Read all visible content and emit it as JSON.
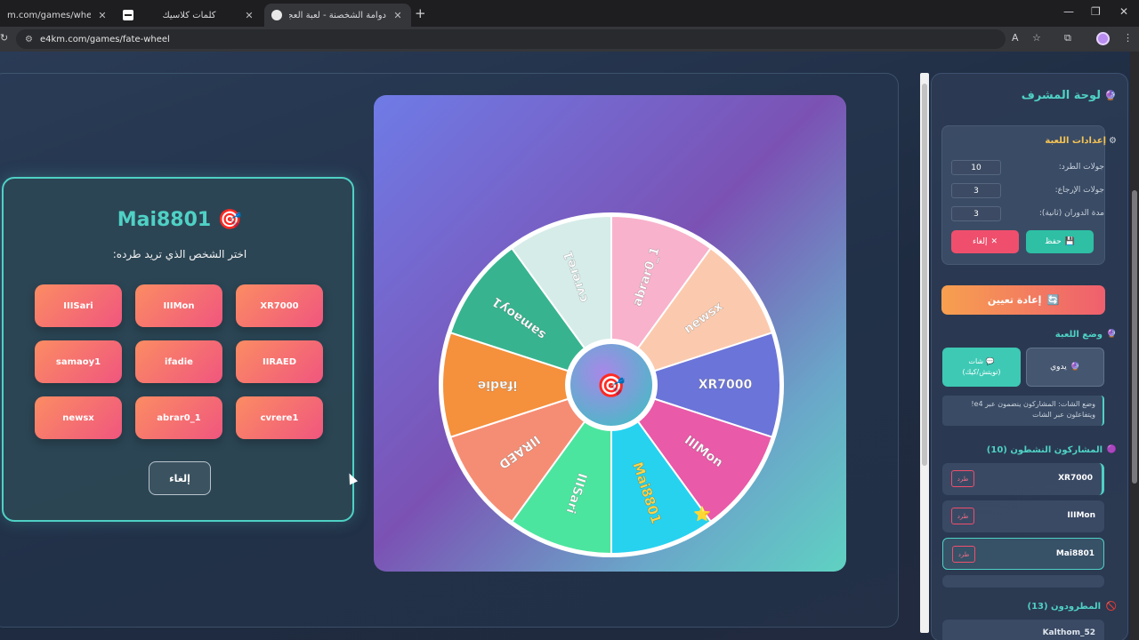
{
  "browser": {
    "tabs": [
      {
        "title": "m.com/games/wheel-of-fat"
      },
      {
        "title": "كلمات كلاسيك"
      },
      {
        "title": "دوامة الشخصنة - لعبة العجلة وال"
      }
    ],
    "url": "e4km.com/games/fate-wheel",
    "new_tab": "+",
    "close_glyph": "✕",
    "win_minimize": "—",
    "win_restore": "❐",
    "win_close": "✕"
  },
  "kick_popup": {
    "player": "Mai8801",
    "title_icon": "🎯",
    "subtitle": "اختر الشخص الذي تريد طرده:",
    "options": [
      "IIISari",
      "IIIMon",
      "XR7000",
      "samaoy1",
      "ifadie",
      "IIRAED",
      "newsx",
      "abrar0_1",
      "cvrere1"
    ],
    "cancel": "إلغاء"
  },
  "wheel": {
    "center_icon": "🎯",
    "segments": [
      {
        "label": "abrar0_1",
        "color": "#f8b2cc"
      },
      {
        "label": "newsx",
        "color": "#fbcaae"
      },
      {
        "label": "XR7000",
        "color": "#6b74d8"
      },
      {
        "label": "IIIMon",
        "color": "#e95aa8"
      },
      {
        "label": "Mai8801",
        "color": "#27d2ef"
      },
      {
        "label": "IIISari",
        "color": "#4ce59f"
      },
      {
        "label": "IIRAED",
        "color": "#f58d74"
      },
      {
        "label": "ifadie",
        "color": "#f5903c"
      },
      {
        "label": "samaoy1",
        "color": "#37b48f"
      },
      {
        "label": "cvrere1",
        "color": "#d6ece9"
      }
    ],
    "highlight": "Mai8801",
    "star_icon": "⭐"
  },
  "admin": {
    "title": "لوحة المشرف",
    "title_icon": "🔮",
    "settings": {
      "title": "إعدادات اللعبة",
      "icon": "⚙",
      "fields": [
        {
          "label": "جولات الطرد:",
          "value": "10"
        },
        {
          "label": "جولات الإرجاع:",
          "value": "3"
        },
        {
          "label": "مدة الدوران (ثانية):",
          "value": "3"
        }
      ],
      "save": "حفظ",
      "save_icon": "💾",
      "cancel": "إلغاء",
      "cancel_icon": "✕"
    },
    "reset": "إعادة تعيين",
    "reset_icon": "🔄",
    "mode": {
      "title": "وضع اللعبة",
      "icon": "🔮",
      "manual": "يدوي",
      "manual_icon": "🔮",
      "chat_line1": "شات",
      "chat_line2": "(تويتش/كيك)",
      "chat_icon": "💬",
      "note": "وضع الشات: المشاركون ينضمون عبر e4!  ويتفاعلون عبر الشات"
    },
    "active": {
      "title": "المشاركون النشطون (10)",
      "icon": "🟣",
      "rows": [
        {
          "name": "XR7000",
          "kick": "طرد"
        },
        {
          "name": "IIIMon",
          "kick": "طرد"
        },
        {
          "name": "Mai8801",
          "kick": "طرد"
        }
      ]
    },
    "kicked": {
      "title": "المطرودون (13)",
      "icon": "🚫",
      "rows": [
        {
          "name": "Kalthom_52"
        }
      ]
    }
  }
}
